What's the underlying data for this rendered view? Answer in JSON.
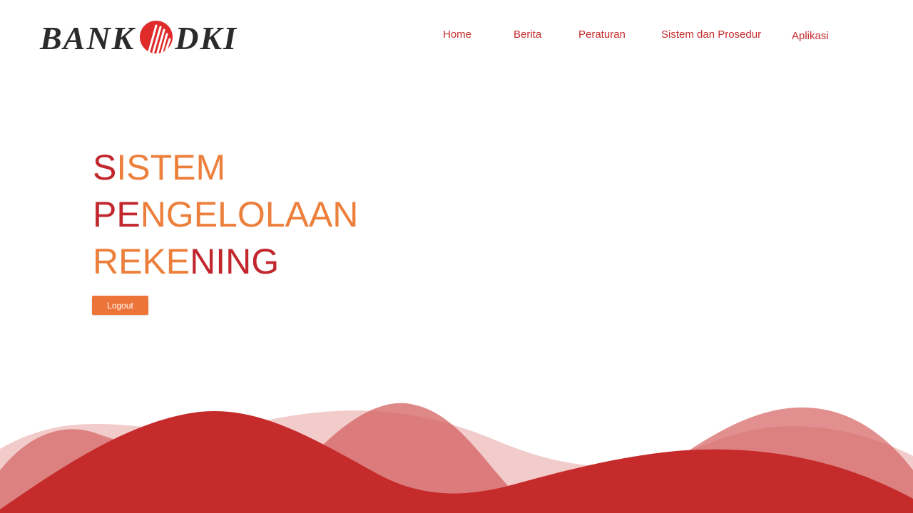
{
  "brand": {
    "name_left": "BANK",
    "name_right": "DKI",
    "logo_red": "#e02b2b",
    "text_color": "#2d2a2a"
  },
  "nav": {
    "items": [
      {
        "label": "Home"
      },
      {
        "label": "Berita"
      },
      {
        "label": "Peraturan"
      },
      {
        "label": "Sistem dan Prosedur"
      },
      {
        "label": "Aplikasi"
      }
    ],
    "color": "#c62b2b"
  },
  "hero": {
    "line1": {
      "red": "S",
      "orange": "ISTEM"
    },
    "line2": {
      "red": "PE",
      "orange": "NGELOLAAN"
    },
    "line3": {
      "orange": "REKE",
      "red": "NING"
    }
  },
  "actions": {
    "logout_label": "Logout"
  },
  "colors": {
    "accent_red": "#c1272d",
    "accent_orange": "#ec7f3b",
    "button_orange": "#ec7439",
    "wave_dark": "#c62b2b",
    "wave_light": "#e8a0a0"
  }
}
